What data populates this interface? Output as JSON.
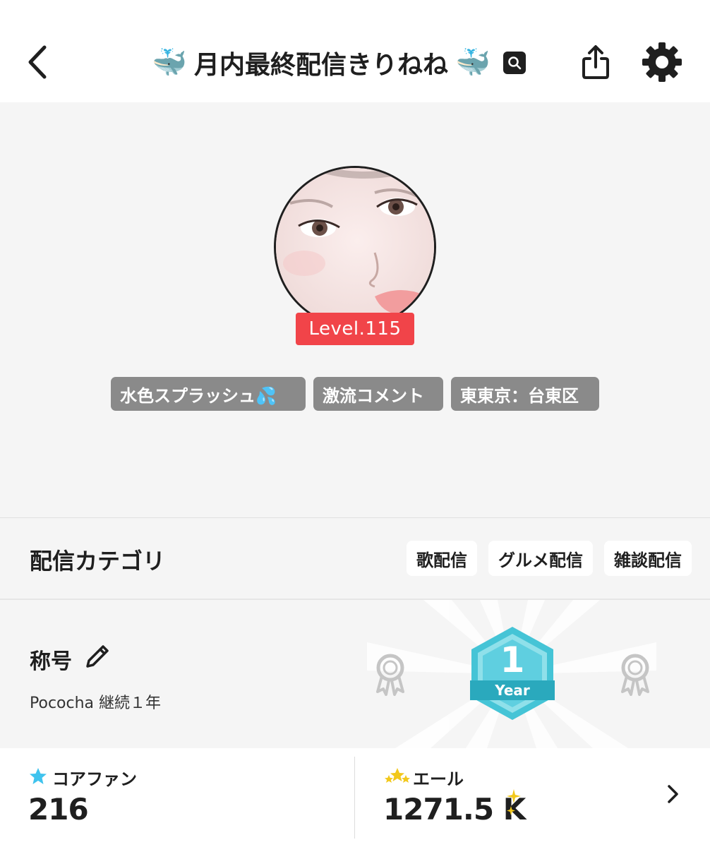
{
  "header": {
    "title": "月内最終配信きりねね",
    "title_emoji": "🐳",
    "icons": [
      "back-chevron-icon",
      "verified-search-icon",
      "share-icon",
      "gear-icon"
    ]
  },
  "profile": {
    "level": "Level.115",
    "tags": [
      "水色スプラッシュ💦",
      "激流コメント",
      "東東京：台東区"
    ]
  },
  "category": {
    "title": "配信カテゴリ",
    "chips": [
      "歌配信",
      "グルメ配信",
      "雑談配信"
    ]
  },
  "title_section": {
    "label": "称号",
    "subtitle": "Pococha 継続１年",
    "badge_number": "1",
    "badge_text": "Year"
  },
  "stats": {
    "core_fan_label": "コアファン",
    "core_fan_value": "216",
    "yell_label": "エール",
    "yell_value": "1271.5 K"
  },
  "colors": {
    "level_red": "#f14449",
    "tag_gray": "#8a8a8a",
    "badge_teal": "#45c4d6",
    "star_blue": "#3fc3ee",
    "star_gold": "#f2c81b"
  }
}
